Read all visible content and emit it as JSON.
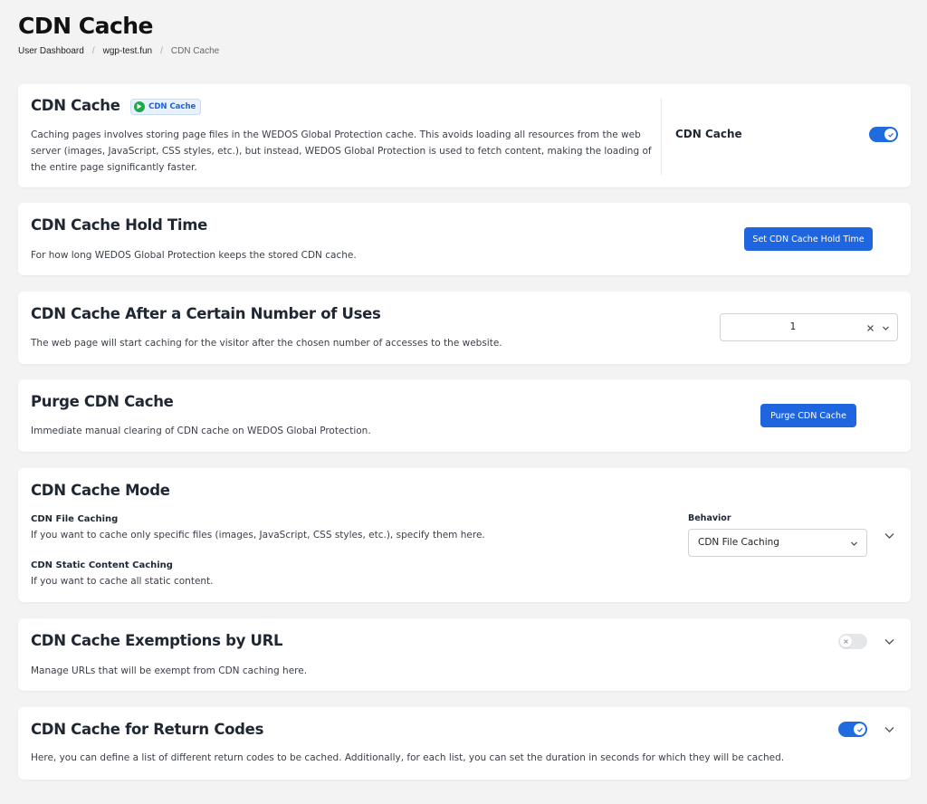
{
  "page": {
    "title": "CDN Cache",
    "breadcrumb": [
      "User Dashboard",
      "wgp-test.fun",
      "CDN Cache"
    ]
  },
  "colors": {
    "accent": "#1f65e0",
    "badge_dot": "#1faa4a",
    "background": "#f3f3f4"
  },
  "cards": {
    "cdn_cache": {
      "title": "CDN Cache",
      "badge": "CDN Cache",
      "description": "Caching pages involves storing page files in the WEDOS Global Protection cache. This avoids loading all resources from the web server (images, JavaScript, CSS styles, etc.), but instead, WEDOS Global Protection is used to fetch content, making the loading of the entire page significantly faster.",
      "toggle_label": "CDN Cache",
      "toggle_on": true
    },
    "hold_time": {
      "title": "CDN Cache Hold Time",
      "description": "For how long WEDOS Global Protection keeps the stored CDN cache.",
      "button": "Set CDN Cache Hold Time"
    },
    "after_uses": {
      "title": "CDN Cache After a Certain Number of Uses",
      "description": "The web page will start caching for the visitor after the chosen number of accesses to the website.",
      "selected": "1"
    },
    "purge": {
      "title": "Purge CDN Cache",
      "description": "Immediate manual clearing of CDN cache on WEDOS Global Protection.",
      "button": "Purge CDN Cache"
    },
    "mode": {
      "title": "CDN Cache Mode",
      "file_caching_title": "CDN File Caching",
      "file_caching_desc": "If you want to cache only specific files (images, JavaScript, CSS styles, etc.), specify them here.",
      "static_title": "CDN Static Content Caching",
      "static_desc": "If you want to cache all static content.",
      "behavior_label": "Behavior",
      "behavior_value": "CDN File Caching"
    },
    "exemptions": {
      "title": "CDN Cache Exemptions by URL",
      "description": "Manage URLs that will be exempt from CDN caching here.",
      "toggle_on": false
    },
    "return_codes": {
      "title": "CDN Cache for Return Codes",
      "description": "Here, you can define a list of different return codes to be cached. Additionally, for each list, you can set the duration in seconds for which they will be cached.",
      "toggle_on": true
    }
  }
}
